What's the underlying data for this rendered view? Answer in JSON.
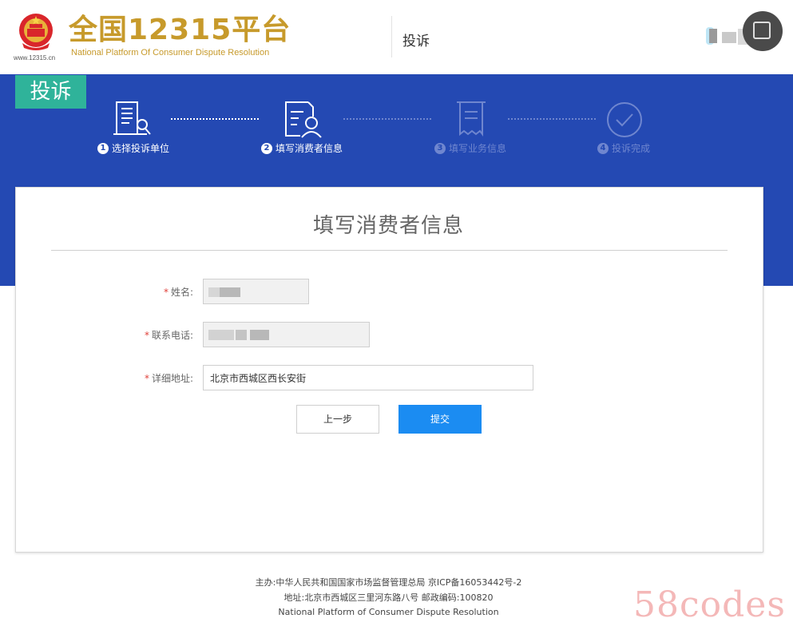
{
  "header": {
    "brand_title": "全国12315平台",
    "brand_subtitle": "National Platform Of Consumer Dispute Resolution",
    "emblem_url": "www.12315.cn",
    "nav_label": "投诉"
  },
  "band": {
    "tag_label": "投诉",
    "steps": [
      {
        "num": "1",
        "label": "选择投诉单位",
        "icon": "building-search-icon",
        "state": "done"
      },
      {
        "num": "2",
        "label": "填写消费者信息",
        "icon": "user-form-icon",
        "state": "active"
      },
      {
        "num": "3",
        "label": "填写业务信息",
        "icon": "receipt-icon",
        "state": "pending"
      },
      {
        "num": "4",
        "label": "投诉完成",
        "icon": "check-circle-icon",
        "state": "pending"
      }
    ]
  },
  "form": {
    "title": "填写消费者信息",
    "fields": [
      {
        "label": "姓名:",
        "value": "",
        "required": true
      },
      {
        "label": "联系电话:",
        "value": "",
        "required": true
      },
      {
        "label": "详细地址:",
        "value": "北京市西城区西长安街",
        "required": true
      }
    ],
    "prev_label": "上一步",
    "submit_label": "提交"
  },
  "footer": {
    "line1": "主办:中华人民共和国国家市场监督管理总局 京ICP备16053442号-2",
    "line2": "地址:北京市西城区三里河东路八号 邮政编码:100820",
    "line3": "National Platform of Consumer Dispute Resolution"
  },
  "watermark": "58codes",
  "colors": {
    "band": "#2449b3",
    "tag": "#2fb39a",
    "brand": "#c79a2b",
    "submit": "#1b8cf2",
    "required": "#e0403a"
  }
}
